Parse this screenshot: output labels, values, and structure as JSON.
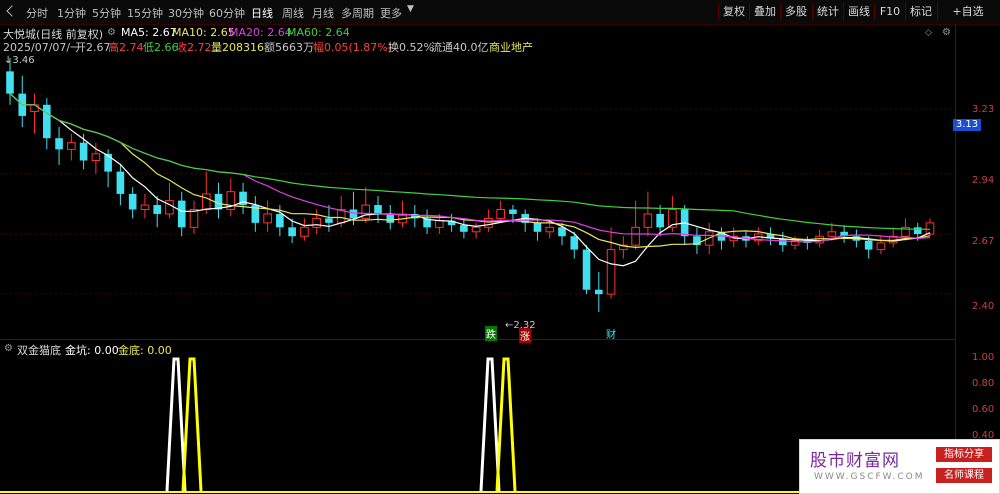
{
  "toolbar": {
    "periods": [
      "分时",
      "1分钟",
      "5分钟",
      "15分钟",
      "30分钟",
      "60分钟",
      "日线",
      "周线",
      "月线",
      "多周期",
      "更多"
    ],
    "active_period": "日线",
    "right_buttons": [
      "复权",
      "叠加",
      "多股",
      "统计",
      "画线",
      "F10",
      "标记",
      "+自选"
    ]
  },
  "header": {
    "title": "大悦城(日线 前复权)",
    "ma": [
      {
        "label": "MA5: 2.67",
        "color": "#ffffff"
      },
      {
        "label": "MA10: 2.65",
        "color": "#e8e85a"
      },
      {
        "label": "MA20: 2.64",
        "color": "#e040e0"
      },
      {
        "label": "MA60: 2.64",
        "color": "#40d040"
      }
    ],
    "quote": {
      "date": "2025/07/07/一",
      "open": "开2.67",
      "high": "高2.74",
      "low": "低2.66",
      "close": "收2.72",
      "vol": "量208316",
      "amount": "额5663万",
      "change": "幅0.05(1.87%)",
      "turnover": "换0.52%",
      "float": "流通40.0亿",
      "sector": "商业地产"
    }
  },
  "price_axis": {
    "labels": [
      "3.23",
      "2.94",
      "2.67",
      "2.40"
    ],
    "current": "3.13"
  },
  "annotations": {
    "high": "3.46",
    "low": "2.32",
    "tag_die": "跌",
    "tag_zhang": "涨",
    "tag_cai": "财"
  },
  "indicator": {
    "name": "双金猫底",
    "jinkeng": "金坑: 0.00",
    "jindi": "金底: 0.00",
    "axis": [
      "1.00",
      "0.80",
      "0.60",
      "0.40"
    ]
  },
  "watermark": {
    "title": "股市财富网",
    "url": "WWW.GSCFW.COM",
    "badge1": "指标分享",
    "badge2": "名师课程"
  },
  "colors": {
    "up": "#ff3030",
    "down": "#40e0f0",
    "ma5": "#ffffff",
    "ma10": "#e8e85a",
    "ma20": "#e040e0",
    "ma60": "#40d040"
  },
  "chart_data": {
    "type": "candlestick",
    "ylim": [
      2.32,
      3.46
    ],
    "candles": [
      [
        3.4,
        3.3,
        3.46,
        3.25
      ],
      [
        3.3,
        3.2,
        3.38,
        3.15
      ],
      [
        3.22,
        3.25,
        3.3,
        3.12
      ],
      [
        3.25,
        3.1,
        3.28,
        3.05
      ],
      [
        3.1,
        3.05,
        3.15,
        2.98
      ],
      [
        3.05,
        3.08,
        3.12,
        3.0
      ],
      [
        3.08,
        3.0,
        3.12,
        2.96
      ],
      [
        3.0,
        3.03,
        3.08,
        2.94
      ],
      [
        3.03,
        2.95,
        3.05,
        2.88
      ],
      [
        2.95,
        2.85,
        2.98,
        2.8
      ],
      [
        2.85,
        2.78,
        2.88,
        2.74
      ],
      [
        2.78,
        2.8,
        2.85,
        2.74
      ],
      [
        2.8,
        2.76,
        2.84,
        2.7
      ],
      [
        2.76,
        2.82,
        2.9,
        2.74
      ],
      [
        2.82,
        2.7,
        2.86,
        2.66
      ],
      [
        2.7,
        2.78,
        2.82,
        2.67
      ],
      [
        2.78,
        2.85,
        2.95,
        2.76
      ],
      [
        2.85,
        2.78,
        2.9,
        2.74
      ],
      [
        2.78,
        2.86,
        2.92,
        2.75
      ],
      [
        2.86,
        2.8,
        2.9,
        2.76
      ],
      [
        2.8,
        2.72,
        2.84,
        2.68
      ],
      [
        2.72,
        2.76,
        2.82,
        2.68
      ],
      [
        2.76,
        2.7,
        2.8,
        2.66
      ],
      [
        2.7,
        2.66,
        2.74,
        2.63
      ],
      [
        2.66,
        2.7,
        2.74,
        2.64
      ],
      [
        2.7,
        2.74,
        2.78,
        2.67
      ],
      [
        2.74,
        2.72,
        2.8,
        2.68
      ],
      [
        2.72,
        2.78,
        2.84,
        2.7
      ],
      [
        2.78,
        2.74,
        2.86,
        2.71
      ],
      [
        2.74,
        2.8,
        2.88,
        2.72
      ],
      [
        2.8,
        2.76,
        2.84,
        2.72
      ],
      [
        2.76,
        2.72,
        2.8,
        2.69
      ],
      [
        2.72,
        2.76,
        2.82,
        2.7
      ],
      [
        2.76,
        2.74,
        2.8,
        2.7
      ],
      [
        2.74,
        2.7,
        2.78,
        2.67
      ],
      [
        2.7,
        2.73,
        2.76,
        2.67
      ],
      [
        2.73,
        2.71,
        2.76,
        2.68
      ],
      [
        2.71,
        2.68,
        2.74,
        2.65
      ],
      [
        2.68,
        2.7,
        2.72,
        2.65
      ],
      [
        2.7,
        2.74,
        2.78,
        2.68
      ],
      [
        2.74,
        2.78,
        2.82,
        2.72
      ],
      [
        2.78,
        2.76,
        2.8,
        2.72
      ],
      [
        2.76,
        2.72,
        2.78,
        2.68
      ],
      [
        2.72,
        2.68,
        2.74,
        2.64
      ],
      [
        2.68,
        2.7,
        2.73,
        2.65
      ],
      [
        2.7,
        2.66,
        2.72,
        2.62
      ],
      [
        2.66,
        2.6,
        2.68,
        2.56
      ],
      [
        2.6,
        2.42,
        2.62,
        2.4
      ],
      [
        2.42,
        2.4,
        2.5,
        2.32
      ],
      [
        2.4,
        2.6,
        2.7,
        2.38
      ],
      [
        2.6,
        2.62,
        2.66,
        2.56
      ],
      [
        2.62,
        2.7,
        2.82,
        2.6
      ],
      [
        2.7,
        2.76,
        2.86,
        2.66
      ],
      [
        2.76,
        2.7,
        2.8,
        2.66
      ],
      [
        2.7,
        2.78,
        2.84,
        2.68
      ],
      [
        2.78,
        2.66,
        2.8,
        2.62
      ],
      [
        2.66,
        2.62,
        2.7,
        2.58
      ],
      [
        2.62,
        2.68,
        2.72,
        2.58
      ],
      [
        2.68,
        2.64,
        2.7,
        2.6
      ],
      [
        2.64,
        2.66,
        2.7,
        2.61
      ],
      [
        2.66,
        2.64,
        2.68,
        2.61
      ],
      [
        2.64,
        2.67,
        2.7,
        2.62
      ],
      [
        2.67,
        2.65,
        2.7,
        2.62
      ],
      [
        2.65,
        2.62,
        2.68,
        2.59
      ],
      [
        2.62,
        2.64,
        2.66,
        2.6
      ],
      [
        2.64,
        2.63,
        2.66,
        2.6
      ],
      [
        2.63,
        2.66,
        2.69,
        2.61
      ],
      [
        2.66,
        2.68,
        2.72,
        2.64
      ],
      [
        2.68,
        2.66,
        2.71,
        2.63
      ],
      [
        2.66,
        2.64,
        2.69,
        2.61
      ],
      [
        2.64,
        2.6,
        2.66,
        2.56
      ],
      [
        2.6,
        2.63,
        2.66,
        2.58
      ],
      [
        2.63,
        2.66,
        2.7,
        2.61
      ],
      [
        2.66,
        2.7,
        2.74,
        2.64
      ],
      [
        2.7,
        2.67,
        2.72,
        2.64
      ],
      [
        2.67,
        2.72,
        2.74,
        2.66
      ]
    ],
    "signals": {
      "white": [
        19,
        560
      ],
      "yellow": [
        40,
        580
      ]
    }
  }
}
